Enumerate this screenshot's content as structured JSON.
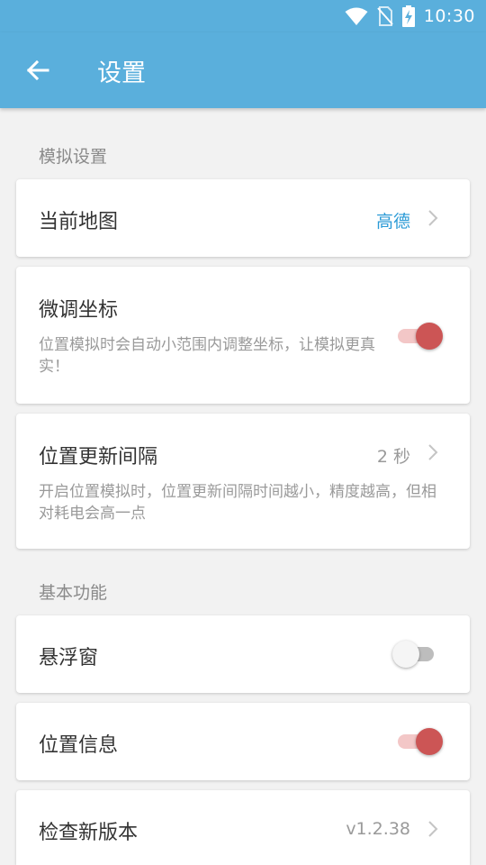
{
  "status_bar": {
    "time": "10:30",
    "icons": [
      "wifi-icon",
      "no-sim-icon",
      "battery-charging-icon"
    ]
  },
  "app_bar": {
    "title": "设置",
    "back_icon": "arrow-left-icon"
  },
  "sections": {
    "simulation": {
      "header": "模拟设置",
      "current_map": {
        "label": "当前地图",
        "value": "高德"
      },
      "fine_tune": {
        "label": "微调坐标",
        "description": "位置模拟时会自动小范围内调整坐标，让模拟更真实！",
        "enabled": true
      },
      "update_interval": {
        "label": "位置更新间隔",
        "value": "2 秒",
        "description": "开启位置模拟时，位置更新间隔时间越小，精度越高，但相对耗电会高一点"
      }
    },
    "basic": {
      "header": "基本功能",
      "floating_window": {
        "label": "悬浮窗",
        "enabled": false
      },
      "location_info": {
        "label": "位置信息",
        "enabled": true
      },
      "check_update": {
        "label": "检查新版本",
        "value": "v1.2.38"
      }
    }
  },
  "colors": {
    "app_bar": "#5aafdc",
    "accent": "#2a9ad6",
    "switch_on": "#cc5555",
    "background": "#f2f2f2"
  }
}
